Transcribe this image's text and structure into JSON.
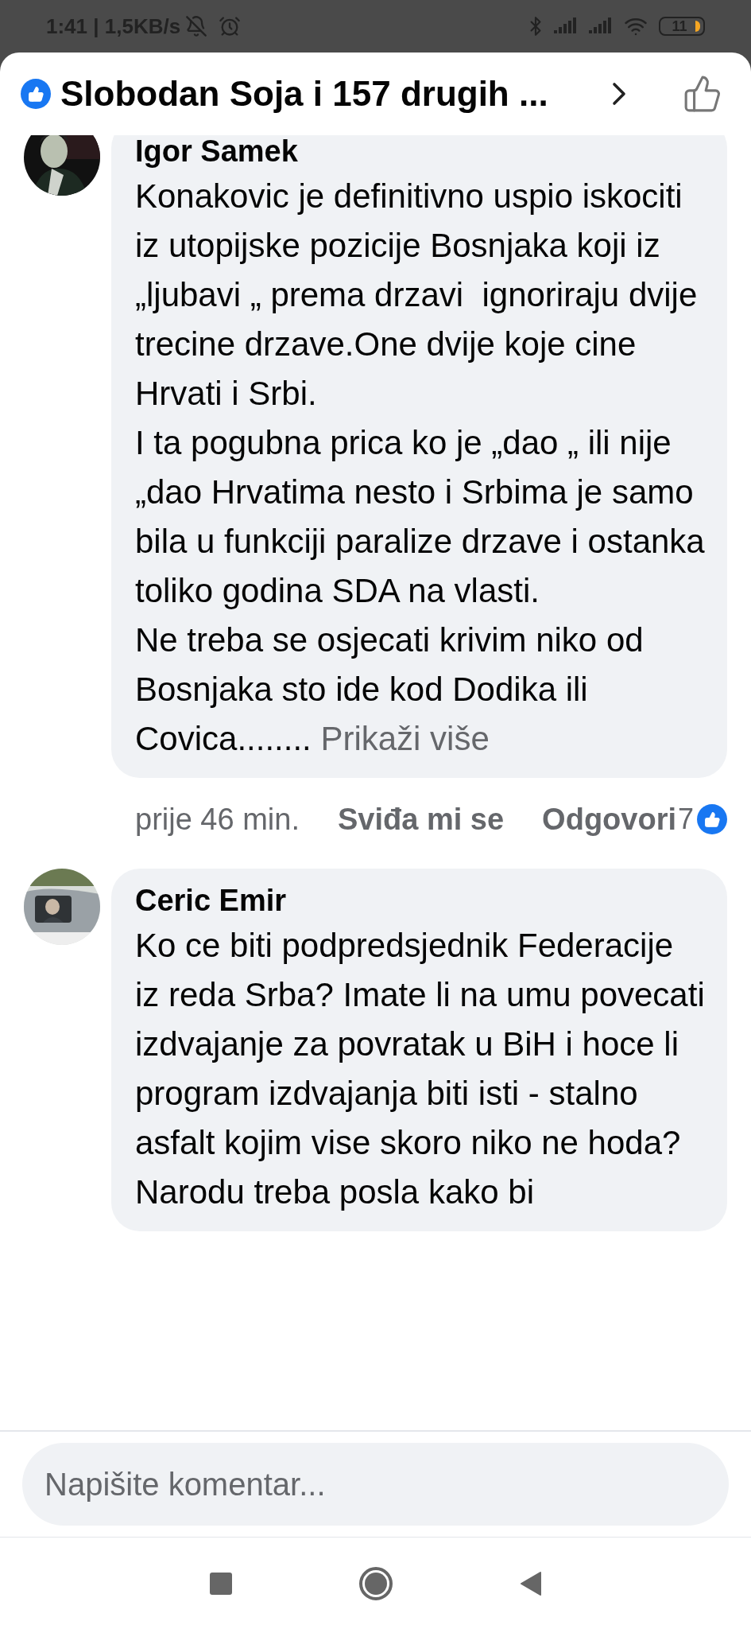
{
  "status_bar": {
    "time": "1:41",
    "separator": "|",
    "network_speed": "1,5KB/s",
    "battery": "11"
  },
  "header": {
    "title": "Slobodan Soja i 157 drugih ..."
  },
  "comments": [
    {
      "author": "Igor Samek",
      "paragraphs": [
        "Konakovic je definitivno uspio iskociti iz utopijske pozicije Bosnjaka koji iz „ljubavi „ prema drzavi  ignoriraju dvije trecine drzave.One dvije koje cine Hrvati i Srbi.",
        "I ta pogubna prica ko je „dao „ ili nije „dao Hrvatima nesto i Srbima je samo bila u funkciji paralize drzave i ostanka toliko godina SDA na vlasti.",
        "Ne treba se osjecati krivim niko od Bosnjaka sto ide kod Dodika ili Covica........"
      ],
      "see_more": "Prikaži više",
      "time": "prije 46 min.",
      "like_action": "Sviđa mi se",
      "reply_action": "Odgovori",
      "reaction_count": "7"
    },
    {
      "author": "Ceric Emir",
      "paragraphs": [
        "Ko ce biti podpredsjednik Federacije iz reda Srba? Imate li na umu povecati izdvajanje za povratak u BiH i hoce li program izdvajanja biti isti - stalno asfalt kojim vise skoro niko ne hoda? Narodu treba posla kako bi"
      ]
    }
  ],
  "composer": {
    "placeholder": "Napišite komentar..."
  }
}
